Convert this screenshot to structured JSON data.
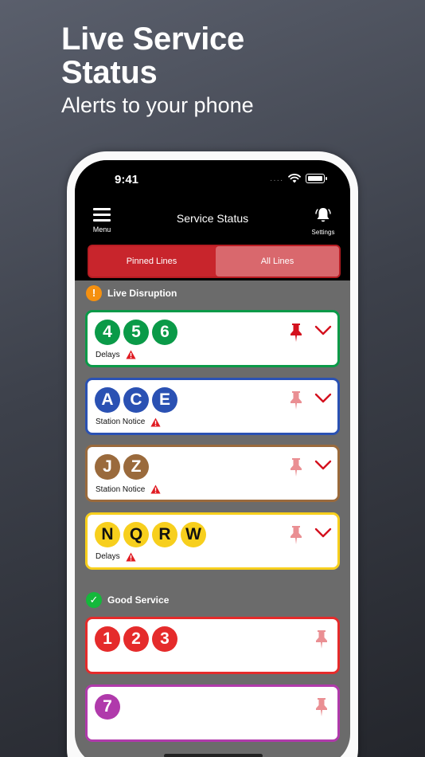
{
  "promo": {
    "title": "Live Service Status",
    "subtitle": "Alerts to your phone"
  },
  "status_bar": {
    "time": "9:41",
    "signal": "····"
  },
  "nav": {
    "menu_label": "Menu",
    "title": "Service Status",
    "settings_label": "Settings"
  },
  "segments": {
    "pinned": "Pinned Lines",
    "all": "All Lines",
    "selected": "All Lines"
  },
  "sections": {
    "disruption": {
      "label": "Live Disruption",
      "icon": "!",
      "icon_color": "#f5900f"
    },
    "good": {
      "label": "Good Service",
      "icon": "✓",
      "icon_color": "#14b83b"
    }
  },
  "colors": {
    "accent_red": "#c8252c",
    "pin_active": "#d4111e",
    "pin_inactive": "#ea8f93",
    "warning": "#e01b22"
  },
  "disruption_cards": [
    {
      "lines": [
        "4",
        "5",
        "6"
      ],
      "line_color": "#0a9a48",
      "text_dark": false,
      "status": "Delays",
      "pinned": true
    },
    {
      "lines": [
        "A",
        "C",
        "E"
      ],
      "line_color": "#2a51b3",
      "text_dark": false,
      "status": "Station Notice",
      "pinned": false
    },
    {
      "lines": [
        "J",
        "Z"
      ],
      "line_color": "#9a6a3c",
      "text_dark": false,
      "status": "Station Notice",
      "pinned": false
    },
    {
      "lines": [
        "N",
        "Q",
        "R",
        "W"
      ],
      "line_color": "#f7cf1d",
      "text_dark": true,
      "status": "Delays",
      "pinned": false
    }
  ],
  "good_cards": [
    {
      "lines": [
        "1",
        "2",
        "3"
      ],
      "line_color": "#e52b2b",
      "text_dark": false,
      "pinned": false
    },
    {
      "lines": [
        "7"
      ],
      "line_color": "#b03aab",
      "text_dark": false,
      "pinned": false
    }
  ]
}
